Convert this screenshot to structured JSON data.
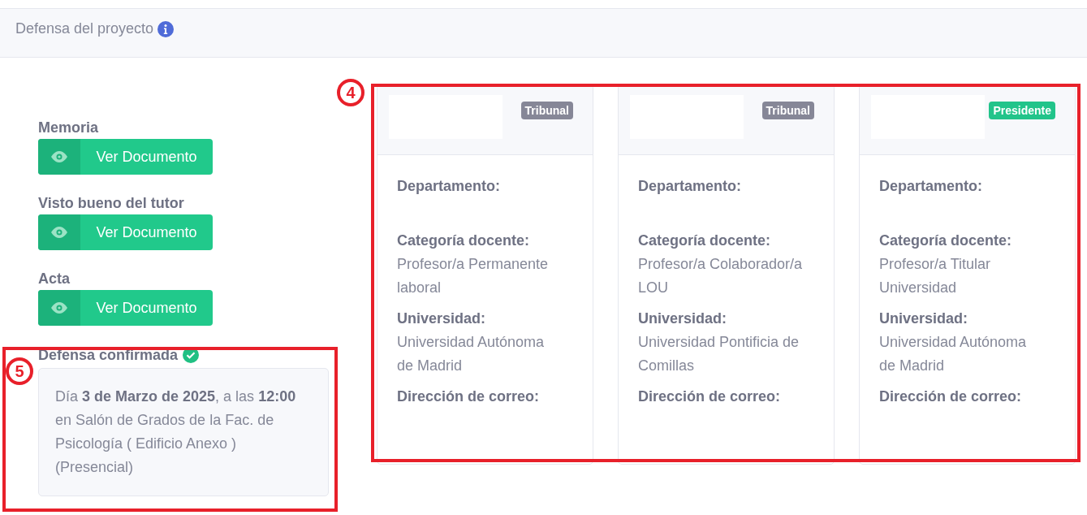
{
  "header": {
    "title": "Defensa del proyecto"
  },
  "documents": [
    {
      "label": "Memoria",
      "button": "Ver Documento"
    },
    {
      "label": "Visto bueno del tutor",
      "button": "Ver Documento"
    },
    {
      "label": "Acta",
      "button": "Ver Documento"
    }
  ],
  "defense": {
    "title": "Defensa confirmada",
    "confirmed": true,
    "details": [
      "Día **3 de Marzo de 2025**, a las **12:00**",
      "en Salón de Grados de la Fac. de Psicología ( Edificio Anexo )",
      "(Presencial)"
    ]
  },
  "members": [
    {
      "badge": {
        "text": "Tribunal",
        "color": "#868797"
      },
      "fields": [
        {
          "label": "Departamento:"
        },
        {
          "label": "Categoría docente:",
          "value": "Profesor/a Permanente laboral"
        },
        {
          "label": "Universidad:",
          "value": "Universidad Autónoma de Madrid"
        },
        {
          "label": "Dirección de correo:"
        }
      ]
    },
    {
      "badge": {
        "text": "Tribunal",
        "color": "#868797"
      },
      "fields": [
        {
          "label": "Departamento:"
        },
        {
          "label": "Categoría docente:",
          "value": "Profesor/a Colaborador/a LOU"
        },
        {
          "label": "Universidad:",
          "value": "Universidad Pontificia de Comillas"
        },
        {
          "label": "Dirección de correo:"
        }
      ]
    },
    {
      "badge": {
        "text": "Presidente",
        "color": "#22c48a"
      },
      "fields": [
        {
          "label": "Departamento:"
        },
        {
          "label": "Categoría docente:",
          "value": "Profesor/a Titular Universidad"
        },
        {
          "label": "Universidad:",
          "value": "Universidad Autónoma de Madrid"
        },
        {
          "label": "Dirección de correo:"
        }
      ]
    }
  ],
  "annotations": [
    {
      "label": "4"
    },
    {
      "label": "5"
    }
  ]
}
